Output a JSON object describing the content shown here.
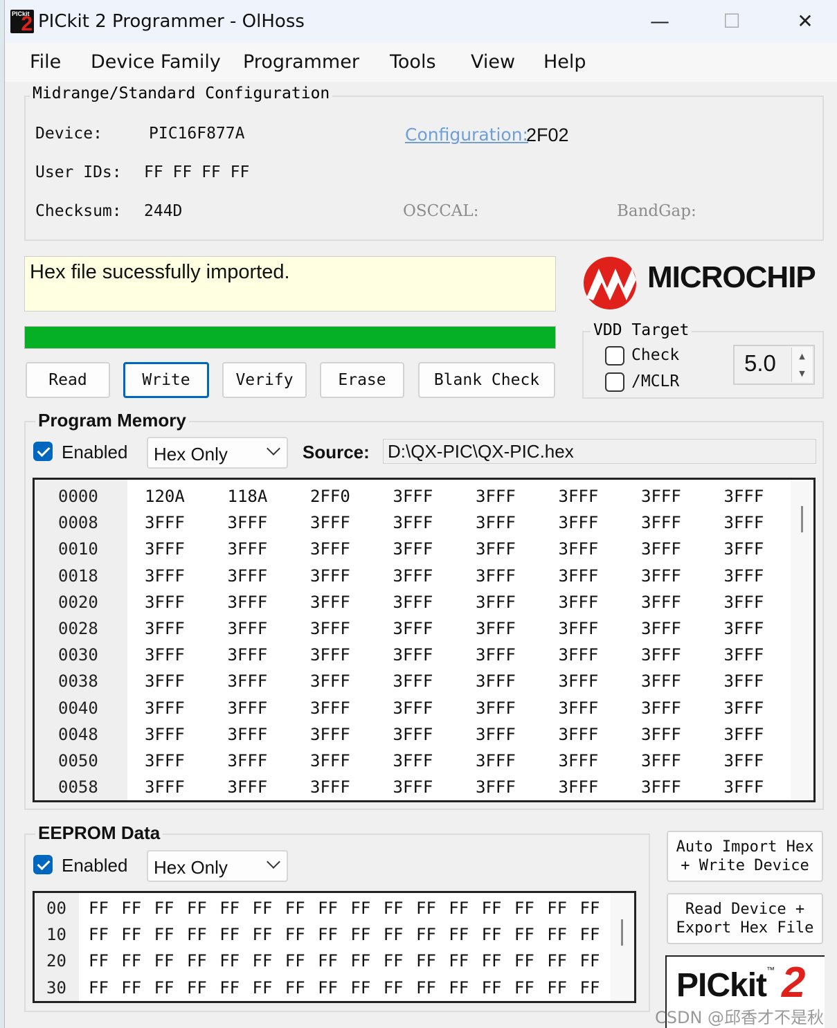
{
  "window": {
    "title": "PICkit 2 Programmer - OlHoss",
    "controls": {
      "minimize": "—",
      "maximize": "☐",
      "close": "✕"
    }
  },
  "menu": [
    "File",
    "Device Family",
    "Programmer",
    "Tools",
    "View",
    "Help"
  ],
  "config": {
    "group_title": "Midrange/Standard Configuration",
    "device_label": "Device:",
    "device_value": "PIC16F877A",
    "userids_label": "User IDs:",
    "userids_value": "FF FF FF FF",
    "checksum_label": "Checksum:",
    "checksum_value": "244D",
    "configuration_link": "Configuration:",
    "configuration_value": "2F02",
    "osccal_label": "OSCCAL:",
    "bandgap_label": "BandGap:"
  },
  "status": {
    "message": "Hex file sucessfully imported.",
    "progress": 1.0,
    "progress_color": "#06b025",
    "background": "#ffffe1"
  },
  "buttons": {
    "read": "Read",
    "write": "Write",
    "verify": "Verify",
    "erase": "Erase",
    "blank_check": "Blank Check"
  },
  "brand": {
    "name": "MICROCHIP",
    "accent": "#e0201b"
  },
  "vdd": {
    "title": "VDD Target",
    "check_label": "Check",
    "check_checked": false,
    "mclr_label": "/MCLR",
    "mclr_checked": false,
    "voltage": "5.0"
  },
  "program_memory": {
    "title": "Program Memory",
    "enabled_label": "Enabled",
    "enabled": true,
    "mode": "Hex Only",
    "source_label": "Source:",
    "source_path": "D:\\QX-PIC\\QX-PIC.hex",
    "rows": [
      {
        "addr": "0000",
        "words": [
          "120A",
          "118A",
          "2FF0",
          "3FFF",
          "3FFF",
          "3FFF",
          "3FFF",
          "3FFF"
        ]
      },
      {
        "addr": "0008",
        "words": [
          "3FFF",
          "3FFF",
          "3FFF",
          "3FFF",
          "3FFF",
          "3FFF",
          "3FFF",
          "3FFF"
        ]
      },
      {
        "addr": "0010",
        "words": [
          "3FFF",
          "3FFF",
          "3FFF",
          "3FFF",
          "3FFF",
          "3FFF",
          "3FFF",
          "3FFF"
        ]
      },
      {
        "addr": "0018",
        "words": [
          "3FFF",
          "3FFF",
          "3FFF",
          "3FFF",
          "3FFF",
          "3FFF",
          "3FFF",
          "3FFF"
        ]
      },
      {
        "addr": "0020",
        "words": [
          "3FFF",
          "3FFF",
          "3FFF",
          "3FFF",
          "3FFF",
          "3FFF",
          "3FFF",
          "3FFF"
        ]
      },
      {
        "addr": "0028",
        "words": [
          "3FFF",
          "3FFF",
          "3FFF",
          "3FFF",
          "3FFF",
          "3FFF",
          "3FFF",
          "3FFF"
        ]
      },
      {
        "addr": "0030",
        "words": [
          "3FFF",
          "3FFF",
          "3FFF",
          "3FFF",
          "3FFF",
          "3FFF",
          "3FFF",
          "3FFF"
        ]
      },
      {
        "addr": "0038",
        "words": [
          "3FFF",
          "3FFF",
          "3FFF",
          "3FFF",
          "3FFF",
          "3FFF",
          "3FFF",
          "3FFF"
        ]
      },
      {
        "addr": "0040",
        "words": [
          "3FFF",
          "3FFF",
          "3FFF",
          "3FFF",
          "3FFF",
          "3FFF",
          "3FFF",
          "3FFF"
        ]
      },
      {
        "addr": "0048",
        "words": [
          "3FFF",
          "3FFF",
          "3FFF",
          "3FFF",
          "3FFF",
          "3FFF",
          "3FFF",
          "3FFF"
        ]
      },
      {
        "addr": "0050",
        "words": [
          "3FFF",
          "3FFF",
          "3FFF",
          "3FFF",
          "3FFF",
          "3FFF",
          "3FFF",
          "3FFF"
        ]
      },
      {
        "addr": "0058",
        "words": [
          "3FFF",
          "3FFF",
          "3FFF",
          "3FFF",
          "3FFF",
          "3FFF",
          "3FFF",
          "3FFF"
        ]
      }
    ]
  },
  "eeprom": {
    "title": "EEPROM Data",
    "enabled_label": "Enabled",
    "enabled": true,
    "mode": "Hex Only",
    "rows": [
      {
        "addr": "00",
        "bytes": [
          "FF",
          "FF",
          "FF",
          "FF",
          "FF",
          "FF",
          "FF",
          "FF",
          "FF",
          "FF",
          "FF",
          "FF",
          "FF",
          "FF",
          "FF",
          "FF"
        ]
      },
      {
        "addr": "10",
        "bytes": [
          "FF",
          "FF",
          "FF",
          "FF",
          "FF",
          "FF",
          "FF",
          "FF",
          "FF",
          "FF",
          "FF",
          "FF",
          "FF",
          "FF",
          "FF",
          "FF"
        ]
      },
      {
        "addr": "20",
        "bytes": [
          "FF",
          "FF",
          "FF",
          "FF",
          "FF",
          "FF",
          "FF",
          "FF",
          "FF",
          "FF",
          "FF",
          "FF",
          "FF",
          "FF",
          "FF",
          "FF"
        ]
      },
      {
        "addr": "30",
        "bytes": [
          "FF",
          "FF",
          "FF",
          "FF",
          "FF",
          "FF",
          "FF",
          "FF",
          "FF",
          "FF",
          "FF",
          "FF",
          "FF",
          "FF",
          "FF",
          "FF"
        ]
      }
    ]
  },
  "side_buttons": {
    "auto_import_line1": "Auto Import Hex",
    "auto_import_line2": "+ Write Device",
    "read_export_line1": "Read Device +",
    "read_export_line2": "Export Hex File"
  },
  "pickit_logo": {
    "text": "PICkit",
    "tm": "™",
    "number": "2"
  },
  "watermark": "CSDN @邱香才不是秋香"
}
